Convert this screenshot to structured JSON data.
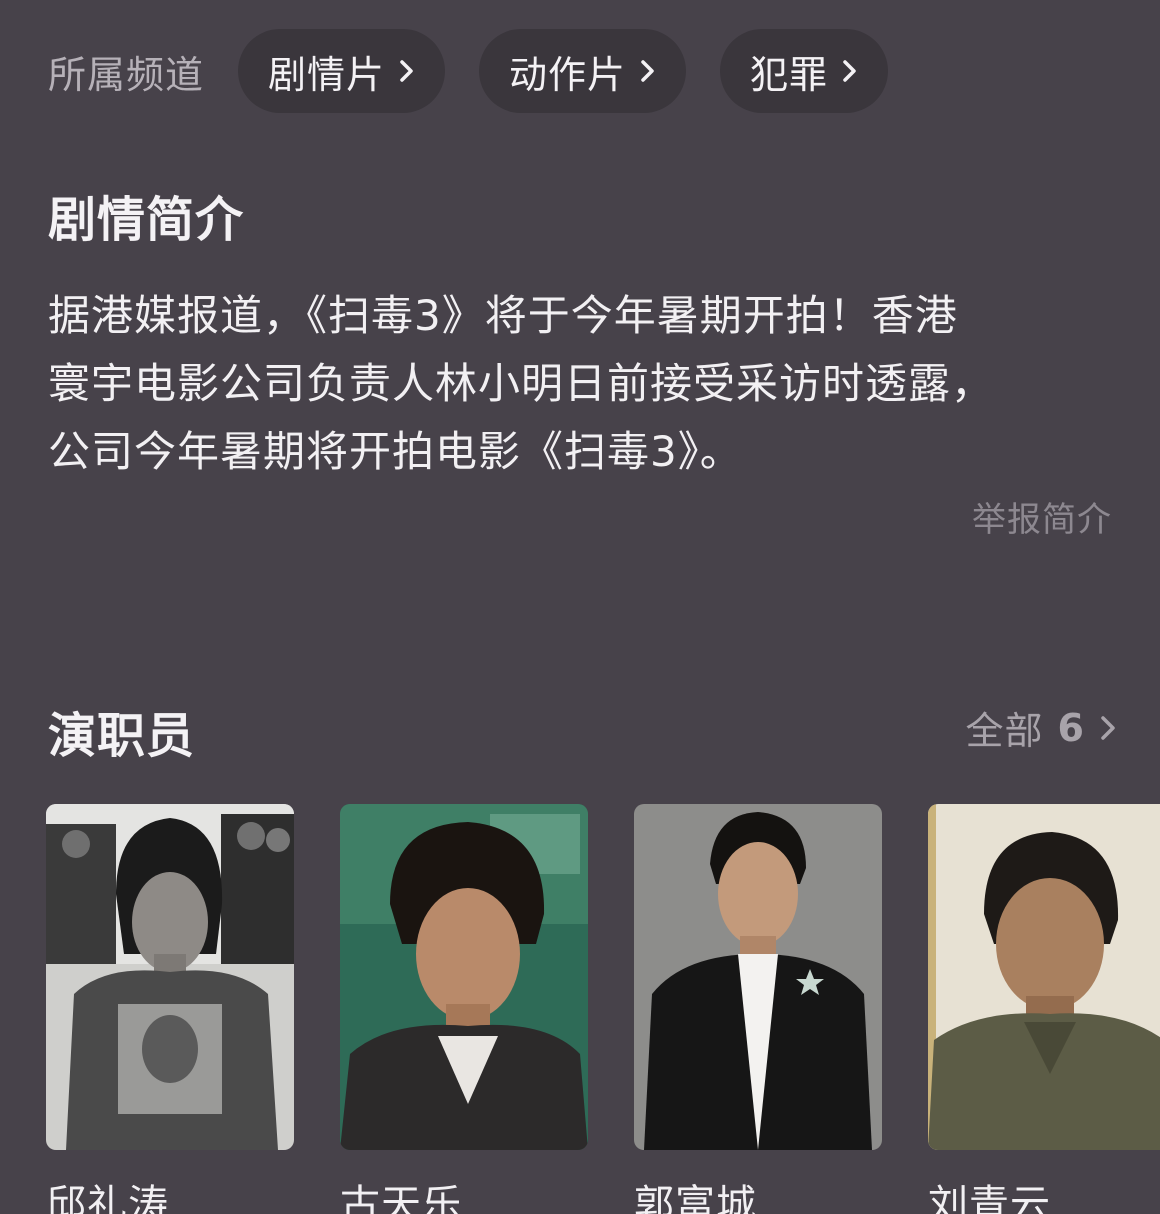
{
  "channels": {
    "label": "所属频道",
    "items": [
      {
        "label": "剧情片"
      },
      {
        "label": "动作片"
      },
      {
        "label": "犯罪"
      }
    ]
  },
  "synopsis": {
    "title": "剧情简介",
    "lines": [
      "据港媒报道，《扫毒3》将于今年暑期开拍！香港",
      "寰宇电影公司负责人林小明日前接受采访时透露，",
      "公司今年暑期将开拍电影《扫毒3》。"
    ],
    "report_label": "举报简介"
  },
  "cast": {
    "title": "演职员",
    "all_label": "全部",
    "all_count": "6",
    "members": [
      {
        "name": "邱礼涛"
      },
      {
        "name": "古天乐"
      },
      {
        "name": "郭富城"
      },
      {
        "name": "刘青云"
      }
    ]
  },
  "colors": {
    "background": "#47424a",
    "chip_background": "#3a363c",
    "primary_text": "#f2f0f3",
    "secondary_text": "#a8a3aa",
    "muted_text": "#8d8890"
  },
  "icons": {
    "chip_arrow": "chevron-right-icon",
    "all_arrow": "chevron-right-icon"
  }
}
